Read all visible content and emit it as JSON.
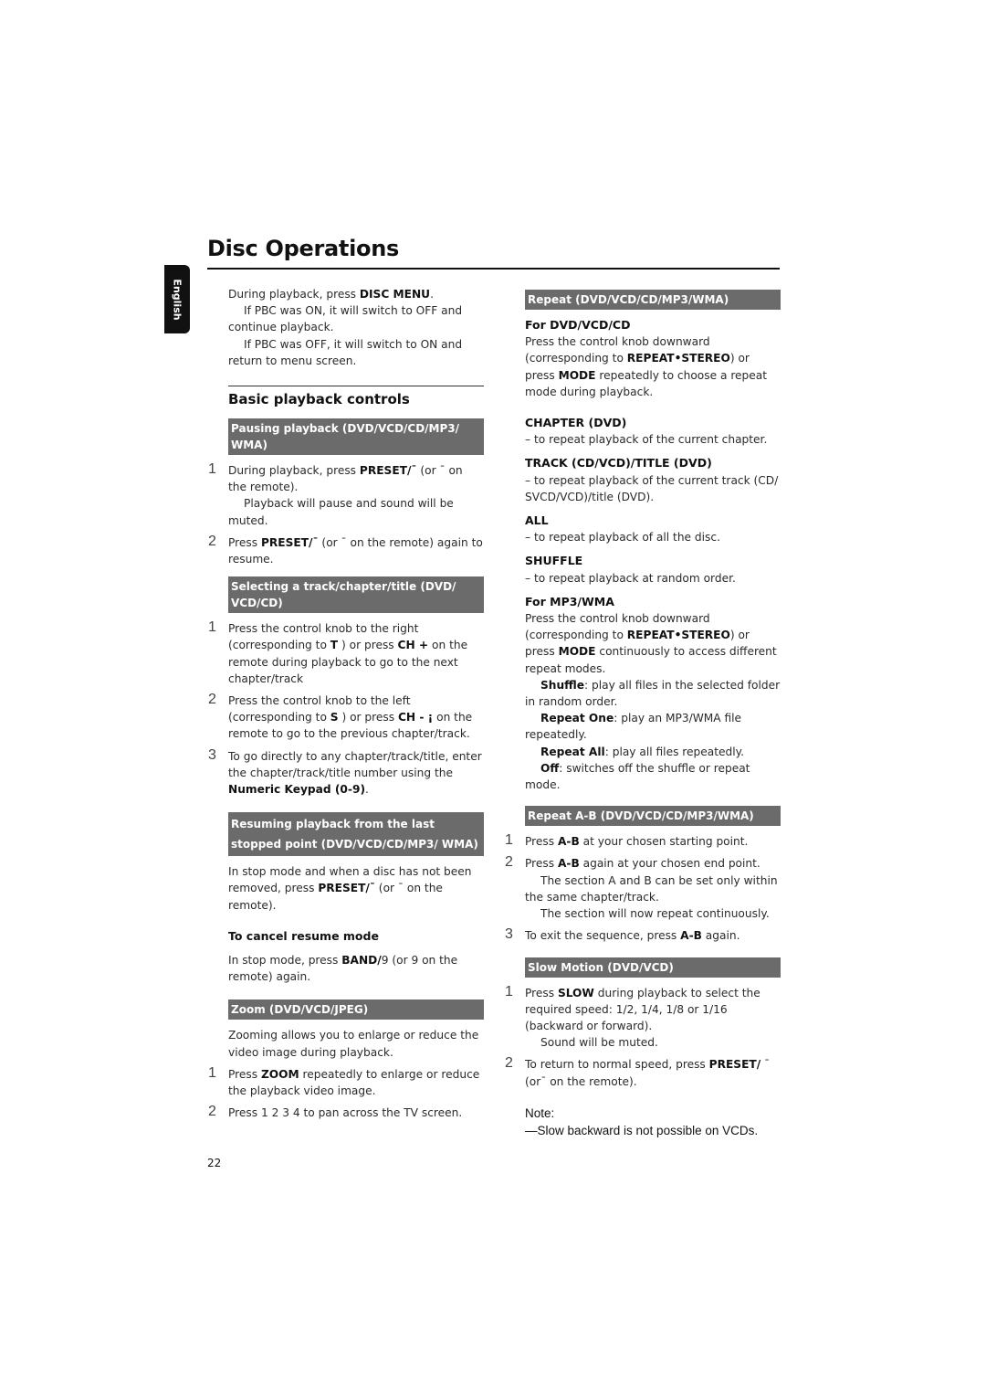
{
  "header": {
    "title": "Disc Operations",
    "language_tab": "English"
  },
  "left": {
    "intro": {
      "line1_pre": "During playback, press ",
      "line1_bold": "DISC MENU",
      "line1_post": ".",
      "pbc_on": "If PBC was ON, it will switch to OFF and continue playback.",
      "pbc_off": "If PBC was OFF, it will switch to ON and return to menu screen."
    },
    "section_title": "Basic playback controls",
    "pausing": {
      "header": "Pausing playback (DVD/VCD/CD/MP3/ WMA)",
      "step1_pre": "During playback, press ",
      "step1_bold": "PRESET/¯",
      "step1_post": "      (or ¯       on the remote).",
      "step1_note": "Playback will pause and sound will be muted.",
      "step2_pre": "Press ",
      "step2_bold": "PRESET/¯",
      "step2_post": "      (or ¯       on the remote) again to resume."
    },
    "selecting": {
      "header": "Selecting a track/chapter/title (DVD/ VCD/CD)",
      "step1_a": "Press the control knob to the right (corresponding to ",
      "step1_b": "T",
      "step1_c": "    ) or press ",
      "step1_d": "CH +",
      "step1_e": "      on the remote during playback to go to the next chapter/track",
      "step2_a": "Press the control knob to the left (corresponding to ",
      "step2_b": "S",
      "step2_c": "    ) or press ",
      "step2_d": "CH - ¡",
      "step2_e": "   on the remote to go to the previous chapter/track.",
      "step3_a": "To go directly to any chapter/track/title, enter the chapter/track/title number using the ",
      "step3_b": "Numeric Keypad (0-9)",
      "step3_c": "."
    },
    "resuming": {
      "header": "Resuming playback from the last stopped point (DVD/VCD/CD/MP3/ WMA)",
      "body_pre": "In stop mode and when a disc has not been removed, press ",
      "body_bold": "PRESET/¯",
      "body_post": "       (or ¯       on the remote).",
      "cancel_title": "To cancel resume mode",
      "cancel_pre": "In stop mode, press ",
      "cancel_bold": "BAND/",
      "cancel_post": "9  (or 9   on the remote) again."
    },
    "zoom": {
      "header": "Zoom (DVD/VCD/JPEG)",
      "intro": "Zooming allows you to enlarge or reduce the video image during playback.",
      "step1_pre": "Press ",
      "step1_bold": "ZOOM",
      "step1_post": " repeatedly to enlarge or reduce the playback video image.",
      "step2": "Press 1 2 3 4       to pan across the TV screen."
    }
  },
  "right": {
    "repeat": {
      "header": "Repeat (DVD/VCD/CD/MP3/WMA)",
      "for_dvd": "For DVD/VCD/CD",
      "dvd_a": "Press the control knob downward (corresponding to ",
      "dvd_b": "REPEAT•STEREO",
      "dvd_c": ") or press ",
      "dvd_d": "MODE",
      "dvd_e": " repeatedly to choose a repeat mode during playback.",
      "modes": [
        {
          "name": "CHAPTER (DVD)",
          "desc": "to repeat playback of the current chapter."
        },
        {
          "name": "TRACK (CD/VCD)/TITLE (DVD)",
          "desc": "to repeat playback of the current track (CD/ SVCD/VCD)/title (DVD)."
        },
        {
          "name": "ALL",
          "desc": "to repeat playback of all the disc."
        },
        {
          "name": "SHUFFLE",
          "desc": "to repeat playback at random order."
        }
      ],
      "for_mp3": "For MP3/WMA",
      "mp3_a": "Press the control knob downward (corresponding to ",
      "mp3_b": "REPEAT•STEREO",
      "mp3_c": ") or press ",
      "mp3_d": "MODE",
      "mp3_e": " continuously to access different repeat modes.",
      "mp3_modes": [
        {
          "name": "Shuffle",
          "desc": ": play all files in the selected folder in random order."
        },
        {
          "name": "Repeat One",
          "desc": ": play an MP3/WMA file repeatedly."
        },
        {
          "name": "Repeat All",
          "desc": ": play all files repeatedly."
        },
        {
          "name": "Off",
          "desc": ": switches off the shuffle or repeat mode."
        }
      ]
    },
    "repeat_ab": {
      "header": "Repeat A-B (DVD/VCD/CD/MP3/WMA)",
      "step1_pre": "Press ",
      "step1_bold": "A-B",
      "step1_post": " at your chosen starting point.",
      "step2_pre": "Press ",
      "step2_bold": "A-B",
      "step2_post": " again at your chosen end point.",
      "step2_note1": "The section A and B can be set only within the same chapter/track.",
      "step2_note2": "The section will now repeat continuously.",
      "step3_pre": "To exit the sequence, press ",
      "step3_bold": "A-B",
      "step3_post": " again."
    },
    "slow": {
      "header": "Slow Motion (DVD/VCD)",
      "step1_pre": "Press ",
      "step1_bold": "SLOW",
      "step1_post": " during playback to select the required speed: 1/2, 1/4, 1/8 or 1/16 (backward or forward).",
      "step1_note": "Sound will be muted.",
      "step2_pre": "To return to normal speed, press ",
      "step2_bold": "PRESET/",
      "step2_post": " ¯        (or¯       on the remote).",
      "note_label": "Note:",
      "note_text": "—Slow backward is not possible on VCDs."
    }
  },
  "footer": {
    "page_number": "22"
  }
}
